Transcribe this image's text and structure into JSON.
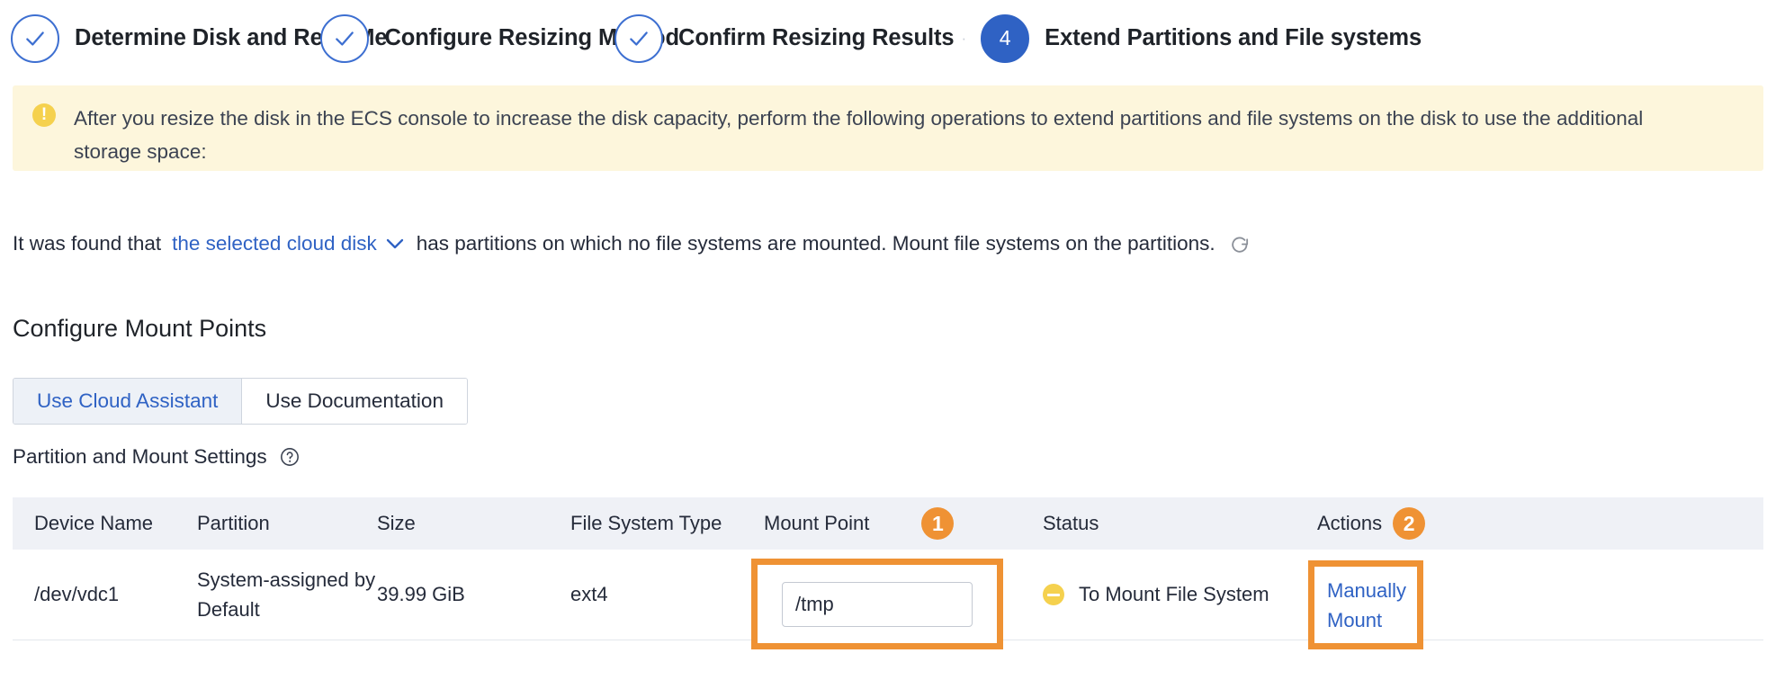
{
  "stepper": {
    "steps": [
      {
        "label": "Determine Disk and Read Me",
        "state": "done",
        "marker": "check"
      },
      {
        "label": "Configure Resizing Method",
        "state": "done",
        "marker": "check"
      },
      {
        "label": "Confirm Resizing Results",
        "state": "done",
        "marker": "check"
      },
      {
        "label": "Extend Partitions and File systems",
        "state": "current",
        "marker": "4"
      }
    ],
    "separator": "·"
  },
  "banner": {
    "icon": "warning-icon",
    "symbol": "!",
    "text": "After you resize the disk in the ECS console to increase the disk capacity, perform the following operations to extend partitions and file systems on the disk to use the additional storage space:"
  },
  "found_line": {
    "prefix": "It was found that",
    "link": "the selected cloud disk",
    "suffix": "has partitions on which no file systems are mounted. Mount file systems on the partitions.",
    "chevron_icon": "chevron-down-icon",
    "refresh_icon": "refresh-icon"
  },
  "section": {
    "title": "Configure Mount Points"
  },
  "tabs": [
    {
      "label": "Use Cloud Assistant",
      "active": true
    },
    {
      "label": "Use Documentation",
      "active": false
    }
  ],
  "settings": {
    "label": "Partition and Mount Settings",
    "help_icon": "help-circle-icon",
    "help_symbol": "?"
  },
  "table": {
    "columns": [
      "Device Name",
      "Partition",
      "Size",
      "File System Type",
      "Mount Point",
      "Status",
      "Actions"
    ],
    "header_badges": {
      "mount_point": "1",
      "actions": "2"
    },
    "rows": [
      {
        "device_name": "/dev/vdc1",
        "partition": "System-assigned by Default",
        "size": "39.99 GiB",
        "file_system_type": "ext4",
        "mount_point_value": "/tmp",
        "mount_point_placeholder": "/tmp",
        "status": "To Mount File System",
        "status_icon": "minus-circle-icon",
        "action": "Manually Mount"
      }
    ]
  },
  "colors": {
    "accent_blue": "#2f62c4",
    "highlight_orange": "#ef9234",
    "banner_bg": "#fdf6dc",
    "warning_yellow": "#f5d14e",
    "table_header_bg": "#eff1f6"
  }
}
